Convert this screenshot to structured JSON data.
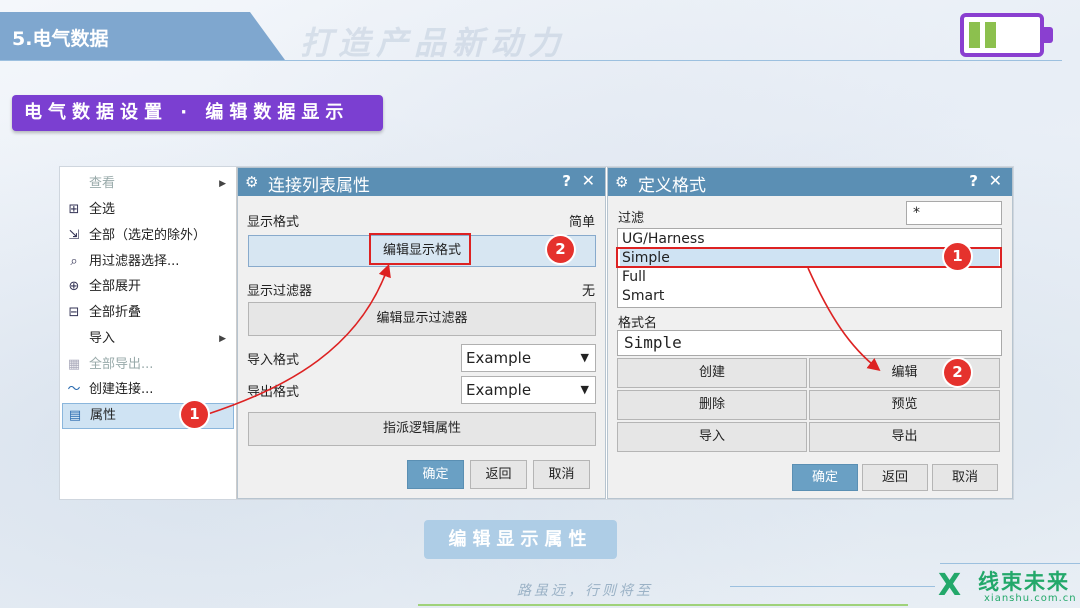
{
  "header": {
    "title": "5.电气数据",
    "watermark": "打造产品新动力"
  },
  "section_label": "电气数据设置 · 编辑数据显示",
  "context_menu": {
    "items": [
      {
        "label": "查看",
        "icon": "",
        "dim": true,
        "submenu": true
      },
      {
        "label": "全选",
        "icon": "select-all-icon"
      },
      {
        "label": "全部（选定的除外）",
        "icon": "select-except-icon"
      },
      {
        "label": "用过滤器选择...",
        "icon": "filter-select-icon"
      },
      {
        "label": "全部展开",
        "icon": "expand-all-icon"
      },
      {
        "label": "全部折叠",
        "icon": "collapse-all-icon"
      },
      {
        "label": "导入",
        "icon": "",
        "submenu": true
      },
      {
        "label": "全部导出...",
        "icon": "export-all-icon",
        "dim": true
      },
      {
        "label": "创建连接...",
        "icon": "create-connection-icon"
      },
      {
        "label": "属性",
        "icon": "properties-icon",
        "selected": true
      }
    ]
  },
  "dialog1": {
    "title": "连接列表属性",
    "help": "?",
    "close": "✕",
    "display_format_label": "显示格式",
    "display_format_value": "简单",
    "edit_display_format": "编辑显示格式",
    "display_filter_label": "显示过滤器",
    "display_filter_value": "无",
    "edit_display_filter": "编辑显示过滤器",
    "import_format_label": "导入格式",
    "import_format_value": "Example",
    "export_format_label": "导出格式",
    "export_format_value": "Example",
    "assign_logic": "指派逻辑属性",
    "ok": "确定",
    "back": "返回",
    "cancel": "取消"
  },
  "dialog2": {
    "title": "定义格式",
    "help": "?",
    "close": "✕",
    "filter_label": "过滤",
    "filter_value": "*",
    "list": [
      "UG/Harness",
      "Simple",
      "Full",
      "Smart"
    ],
    "format_name_label": "格式名",
    "format_name_value": "Simple",
    "create": "创建",
    "edit": "编辑",
    "delete": "删除",
    "preview": "预览",
    "import": "导入",
    "export": "导出",
    "ok": "确定",
    "back": "返回",
    "cancel": "取消"
  },
  "annotations": {
    "step1": "1",
    "step2": "2"
  },
  "caption": "编辑显示属性",
  "slogan": "路虽远，行则将至",
  "logo": {
    "mark": "X",
    "name": "线束未来",
    "url": "xianshu.com.cn"
  },
  "colors": {
    "accent_purple": "#7b3fd1",
    "title_blue": "#5b8fb4",
    "annotation_red": "#e5322d",
    "logo_green": "#23a86a"
  }
}
